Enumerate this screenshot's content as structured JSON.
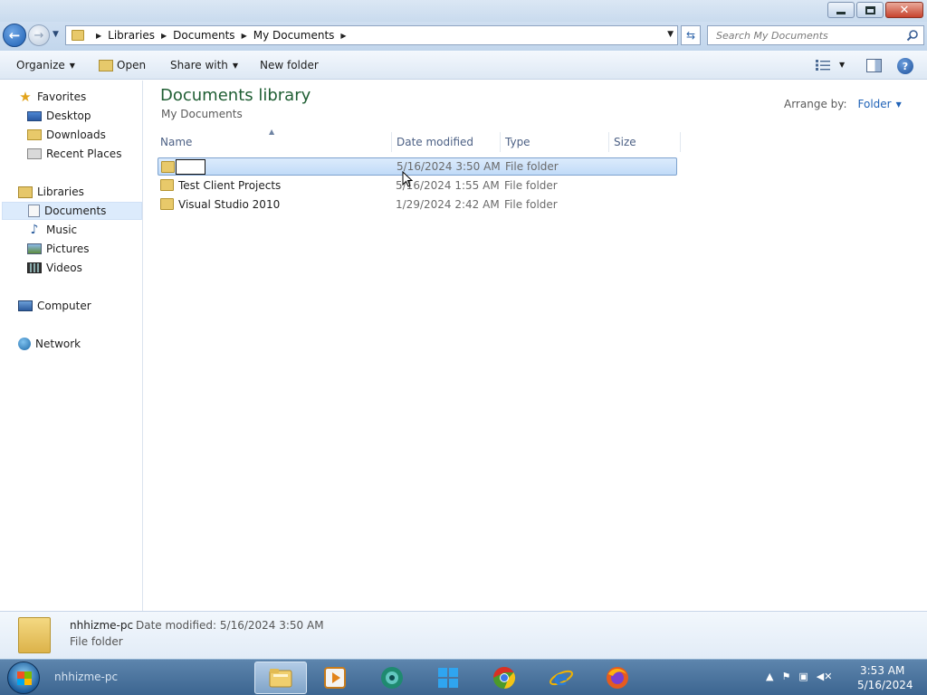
{
  "window": {
    "controls": {
      "minimize": "minimize",
      "maximize": "maximize",
      "close": "x"
    }
  },
  "address": {
    "crumbs": [
      "Libraries",
      "Documents",
      "My Documents"
    ],
    "search_placeholder": "Search My Documents"
  },
  "toolbar": {
    "organize": "Organize",
    "open": "Open",
    "share_with": "Share with",
    "new_folder": "New folder"
  },
  "nav": {
    "favorites": "Favorites",
    "desktop": "Desktop",
    "downloads": "Downloads",
    "recent_places": "Recent Places",
    "libraries": "Libraries",
    "documents": "Documents",
    "music": "Music",
    "pictures": "Pictures",
    "videos": "Videos",
    "computer": "Computer",
    "network": "Network"
  },
  "content": {
    "title": "Documents library",
    "subtitle": "My Documents",
    "arrange_label": "Arrange by:",
    "arrange_value": "Folder",
    "columns": {
      "name": "Name",
      "date": "Date modified",
      "type": "Type",
      "size": "Size"
    },
    "rows": [
      {
        "name": "",
        "date": "5/16/2024 3:50 AM",
        "type": "File folder",
        "renaming": true
      },
      {
        "name": "Test Client Projects",
        "date": "5/16/2024 1:55 AM",
        "type": "File folder"
      },
      {
        "name": "Visual Studio 2010",
        "date": "1/29/2024 2:42 AM",
        "type": "File folder"
      }
    ]
  },
  "details": {
    "name": "nhhizme-pc",
    "modified": "Date modified: 5/16/2024 3:50 AM",
    "type": "File folder"
  },
  "taskbar": {
    "hostname": "nhhizme-pc",
    "time": "3:53 AM",
    "date": "5/16/2024",
    "apps": [
      "windows-explorer-icon",
      "media-player-icon",
      "chat-app-icon",
      "windows-logo-icon",
      "chrome-icon",
      "internet-explorer-icon",
      "firefox-icon"
    ]
  },
  "colors": {
    "library_title": "#1f5e33",
    "selection_bg": "#c1dbf8",
    "selection_border": "#7da2ce",
    "link_blue": "#1f62b7",
    "taskbar": "#3c6590"
  }
}
